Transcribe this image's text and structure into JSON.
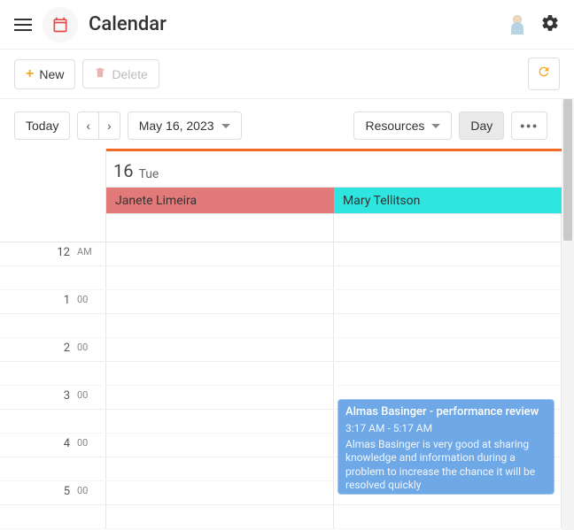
{
  "header": {
    "app_title": "Calendar"
  },
  "toolbar": {
    "new_label": "New",
    "delete_label": "Delete"
  },
  "controls": {
    "today_label": "Today",
    "date_label": "May 16, 2023",
    "resources_label": "Resources",
    "day_label": "Day"
  },
  "day": {
    "number": "16",
    "weekday": "Tue"
  },
  "resources": [
    {
      "name": "Janete Limeira",
      "color": "#e27a7a"
    },
    {
      "name": "Mary Tellitson",
      "color": "#2fe5e0"
    }
  ],
  "time_slots": [
    {
      "hour": "12",
      "suffix": "AM"
    },
    {
      "hour": "1",
      "suffix": "00"
    },
    {
      "hour": "2",
      "suffix": "00"
    },
    {
      "hour": "3",
      "suffix": "00"
    },
    {
      "hour": "4",
      "suffix": "00"
    },
    {
      "hour": "5",
      "suffix": "00"
    }
  ],
  "events": [
    {
      "title": "Almas Basinger - performance review",
      "time": "3:17 AM - 5:17 AM",
      "description": "Almas Basinger is very good at sharing knowledge and information during a problem to increase the chance it will be resolved quickly",
      "resource_index": 1,
      "start_slot": 3.28,
      "end_slot": 5.28
    }
  ]
}
